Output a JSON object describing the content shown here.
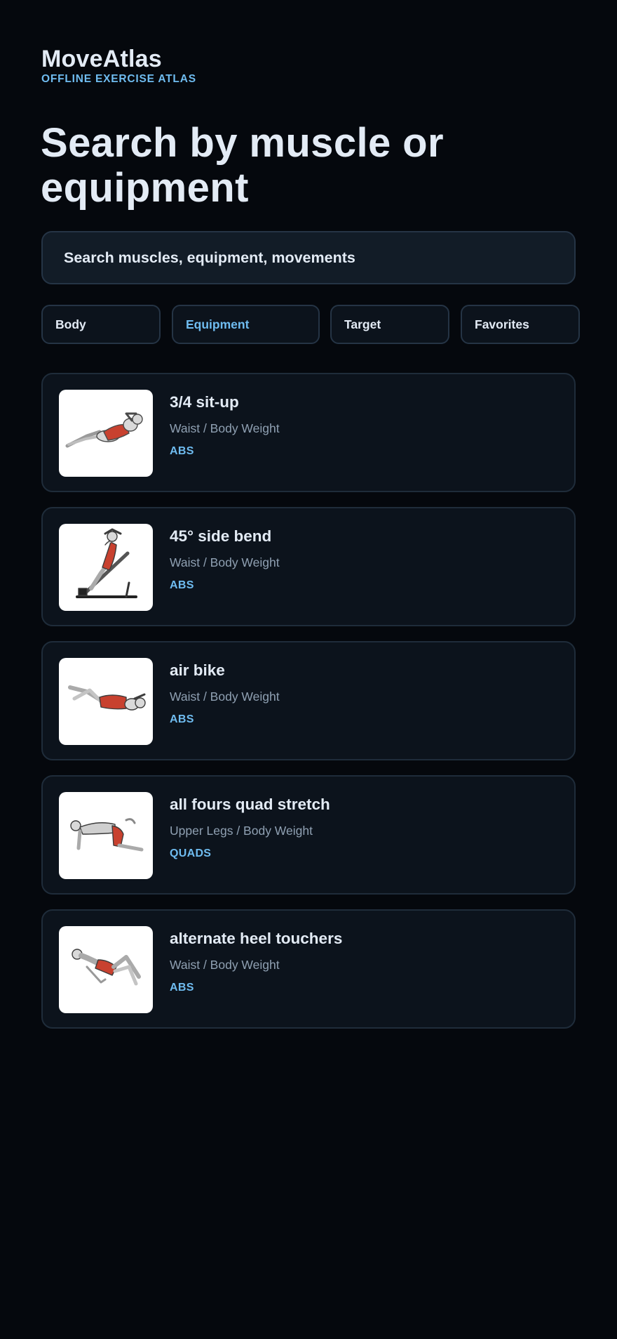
{
  "app": {
    "name": "MoveAtlas",
    "tagline": "OFFLINE EXERCISE ATLAS"
  },
  "headline": "Search by muscle or equipment",
  "search": {
    "placeholder": "Search muscles, equipment, movements"
  },
  "tabs": [
    {
      "label": "Body",
      "active": false
    },
    {
      "label": "Equipment",
      "active": true
    },
    {
      "label": "Target",
      "active": false
    },
    {
      "label": "Favorites",
      "active": false
    }
  ],
  "exercises": [
    {
      "name": "3/4 sit-up",
      "meta": "Waist / Body Weight",
      "target": "ABS",
      "image": "sit-up-illustration"
    },
    {
      "name": "45° side bend",
      "meta": "Waist / Body Weight",
      "target": "ABS",
      "image": "side-bend-illustration"
    },
    {
      "name": "air bike",
      "meta": "Waist / Body Weight",
      "target": "ABS",
      "image": "air-bike-illustration"
    },
    {
      "name": "all fours quad stretch",
      "meta": "Upper Legs / Body Weight",
      "target": "QUADS",
      "image": "quad-stretch-illustration"
    },
    {
      "name": "alternate heel touchers",
      "meta": "Waist / Body Weight",
      "target": "ABS",
      "image": "heel-touchers-illustration"
    }
  ],
  "colors": {
    "background": "#05080d",
    "accent": "#6fbcf0",
    "text": "#e3ebf5",
    "muted": "#8fa0b2",
    "highlight_muscle": "#c8412f"
  }
}
